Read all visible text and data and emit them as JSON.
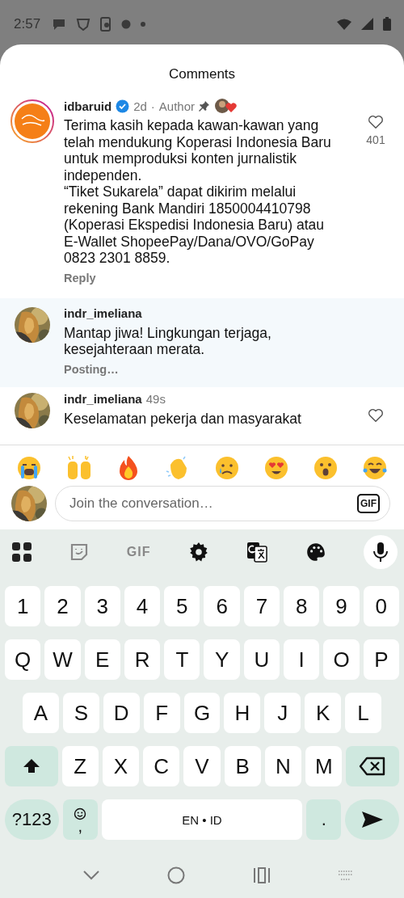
{
  "status_bar": {
    "time": "2:57"
  },
  "sheet": {
    "title": "Comments"
  },
  "comments": [
    {
      "username": "idbaruid",
      "verified": true,
      "time": "2d",
      "separator": "·",
      "badge": "Author",
      "pinned": true,
      "creator_liked": true,
      "highlighted": false,
      "text": "Terima kasih kepada kawan-kawan yang telah mendukung Koperasi Indonesia Baru untuk memproduksi konten jurnalistik independen.\n“Tiket Sukarela” dapat dikirim melalui rekening Bank Mandiri 1850004410798 (Koperasi Ekspedisi Indonesia Baru) atau E-Wallet ShopeePay/Dana/OVO/GoPay 0823 2301 8859.",
      "likes": "401",
      "footer": "Reply",
      "kind": "brand"
    },
    {
      "username": "indr_imeliana",
      "highlighted": true,
      "text": "Mantap jiwa! Lingkungan terjaga, kesejahteraan merata.",
      "footer": "Posting…",
      "kind": "user"
    },
    {
      "username": "indr_imeliana",
      "time": "49s",
      "highlighted": false,
      "text": "Keselamatan pekerja dan masyarakat",
      "kind": "user",
      "like_button": true
    }
  ],
  "reactions": [
    {
      "kind": "crying"
    },
    {
      "kind": "raised-hands"
    },
    {
      "kind": "fire"
    },
    {
      "kind": "clap"
    },
    {
      "kind": "sad"
    },
    {
      "kind": "heart-eyes"
    },
    {
      "kind": "surprised"
    },
    {
      "kind": "laughing"
    }
  ],
  "composer": {
    "placeholder": "Join the conversation…",
    "gif_label": "GIF"
  },
  "keyboard": {
    "toolbar": [
      {
        "kind": "apps"
      },
      {
        "kind": "sticker"
      },
      {
        "kind": "gif",
        "label": "GIF"
      },
      {
        "kind": "settings"
      },
      {
        "kind": "translate"
      },
      {
        "kind": "palette"
      },
      {
        "kind": "mic"
      }
    ],
    "rows": [
      [
        {
          "label": "1"
        },
        {
          "label": "2"
        },
        {
          "label": "3"
        },
        {
          "label": "4"
        },
        {
          "label": "5"
        },
        {
          "label": "6"
        },
        {
          "label": "7"
        },
        {
          "label": "8"
        },
        {
          "label": "9"
        },
        {
          "label": "0"
        }
      ],
      [
        {
          "label": "Q"
        },
        {
          "label": "W"
        },
        {
          "label": "E"
        },
        {
          "label": "R"
        },
        {
          "label": "T"
        },
        {
          "label": "Y"
        },
        {
          "label": "U"
        },
        {
          "label": "I"
        },
        {
          "label": "O"
        },
        {
          "label": "P"
        }
      ],
      [
        {
          "label": "A"
        },
        {
          "label": "S"
        },
        {
          "label": "D"
        },
        {
          "label": "F"
        },
        {
          "label": "G"
        },
        {
          "label": "H"
        },
        {
          "label": "J"
        },
        {
          "label": "K"
        },
        {
          "label": "L"
        }
      ],
      [
        {
          "kind": "shift"
        },
        {
          "label": "Z"
        },
        {
          "label": "X"
        },
        {
          "label": "C"
        },
        {
          "label": "V"
        },
        {
          "label": "B"
        },
        {
          "label": "N"
        },
        {
          "label": "M"
        },
        {
          "kind": "backspace"
        }
      ],
      [
        {
          "kind": "symbols",
          "label": "?123"
        },
        {
          "kind": "emoji-comma",
          "label": ","
        },
        {
          "kind": "space",
          "label": "EN • ID"
        },
        {
          "kind": "period",
          "label": "."
        },
        {
          "kind": "send"
        }
      ]
    ]
  }
}
